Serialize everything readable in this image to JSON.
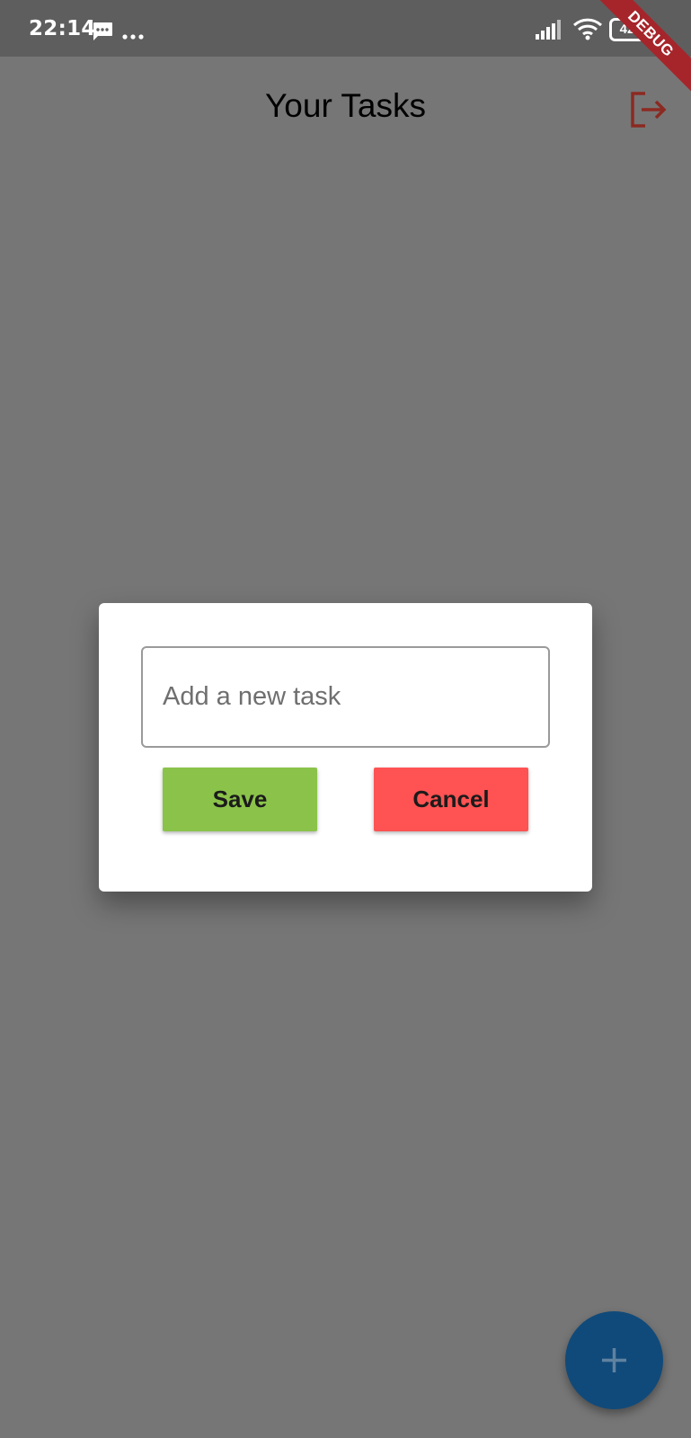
{
  "status_bar": {
    "time": "22:14",
    "battery": "42",
    "icons": [
      "message-icon",
      "more-dots-icon",
      "signal-icon",
      "wifi-icon",
      "battery-icon"
    ]
  },
  "debug_banner": "DEBUG",
  "app_bar": {
    "title": "Your Tasks",
    "logout_icon": "logout-icon"
  },
  "dialog": {
    "input_placeholder": "Add a new task",
    "input_value": "",
    "save_label": "Save",
    "cancel_label": "Cancel"
  },
  "fab": {
    "icon": "plus-icon"
  },
  "colors": {
    "scrim": "#767676",
    "save": "#8bc34a",
    "cancel": "#ff5252",
    "fab": "#104a7a",
    "logout": "#8b2a22"
  }
}
